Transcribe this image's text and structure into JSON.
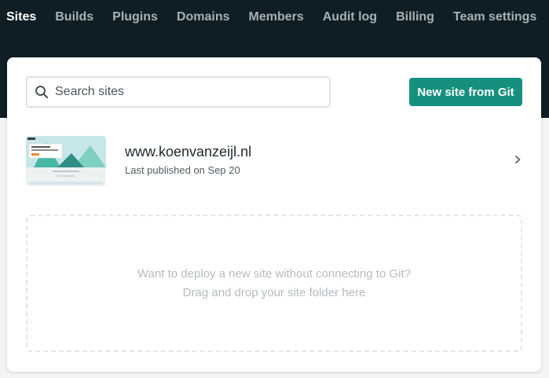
{
  "nav": {
    "items": [
      {
        "label": "Sites",
        "active": true
      },
      {
        "label": "Builds"
      },
      {
        "label": "Plugins"
      },
      {
        "label": "Domains"
      },
      {
        "label": "Members"
      },
      {
        "label": "Audit log"
      },
      {
        "label": "Billing"
      },
      {
        "label": "Team settings"
      }
    ]
  },
  "search": {
    "placeholder": "Search sites",
    "value": "",
    "icon": "search-icon"
  },
  "toolbar": {
    "new_site_label": "New site from Git"
  },
  "sites": [
    {
      "name": "www.koenvanzeijl.nl",
      "meta": "Last published on Sep 20",
      "thumbnail_icon": "site-screenshot",
      "chevron_icon": "chevron-right-icon"
    }
  ],
  "dropzone": {
    "line1": "Want to deploy a new site without connecting to Git?",
    "line2": "Drag and drop your site folder here"
  },
  "colors": {
    "topbar": "#0f1e25",
    "accent": "#15907f",
    "nav_active": "#ffffff",
    "nav_inactive": "#a7b1b6"
  }
}
